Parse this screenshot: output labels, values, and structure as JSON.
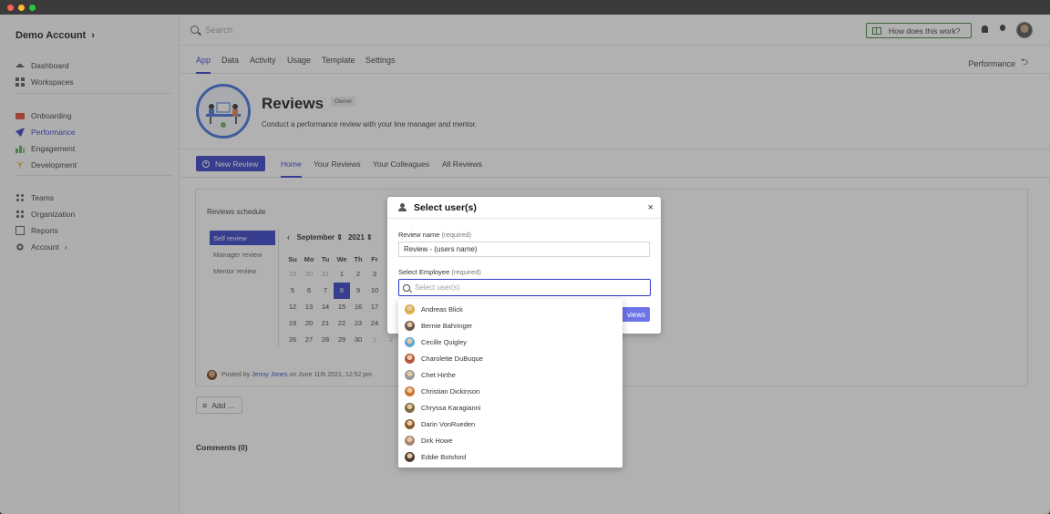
{
  "window": {
    "controls": {
      "close_color": "#ff5f57",
      "minimize_color": "#febc2e",
      "maximize_color": "#28c840"
    }
  },
  "sidebar": {
    "account_title": "Demo Account",
    "account_chevron": "›",
    "groups": [
      [
        {
          "label": "Dashboard",
          "icon": "home-icon"
        },
        {
          "label": "Workspaces",
          "icon": "grid-icon"
        }
      ],
      [
        {
          "label": "Onboarding",
          "icon": "flag-icon"
        },
        {
          "label": "Performance",
          "icon": "paper-plane-icon",
          "active": true
        },
        {
          "label": "Engagement",
          "icon": "chart-icon"
        },
        {
          "label": "Development",
          "icon": "sprout-icon"
        }
      ],
      [
        {
          "label": "Teams",
          "icon": "org-icon"
        },
        {
          "label": "Organization",
          "icon": "network-icon"
        },
        {
          "label": "Reports",
          "icon": "report-icon"
        },
        {
          "label": "Account",
          "icon": "gear-icon",
          "chevron": "›"
        }
      ]
    ]
  },
  "topbar": {
    "search_placeholder": "Search",
    "help_label": "How does this work?"
  },
  "app_tabs": [
    "App",
    "Data",
    "Activity",
    "Usage",
    "Template",
    "Settings"
  ],
  "app_tab_active": "App",
  "performance_link": "Performance",
  "header": {
    "title": "Reviews",
    "badge": "Owner",
    "subtitle": "Conduct a performance review with your line manager and mentor."
  },
  "subnav": {
    "new_review": "New Review",
    "tabs": [
      "Home",
      "Your Reviews",
      "Your Colleagues",
      "All Reviews"
    ],
    "active": "Home"
  },
  "schedule": {
    "title": "Reviews schedule",
    "types": [
      "Self review",
      "Manager review",
      "Mentor review"
    ],
    "active_type": "Self review",
    "calendar": {
      "prev": "‹",
      "month": "September",
      "year": "2021",
      "day_headers": [
        "Su",
        "Mo",
        "Tu",
        "We",
        "Th",
        "Fr"
      ],
      "weeks": [
        [
          "29",
          "30",
          "31",
          "1",
          "2",
          "3"
        ],
        [
          "5",
          "6",
          "7",
          "8",
          "9",
          "10"
        ],
        [
          "12",
          "13",
          "14",
          "15",
          "16",
          "17"
        ],
        [
          "19",
          "20",
          "21",
          "22",
          "23",
          "24"
        ],
        [
          "26",
          "27",
          "28",
          "29",
          "30",
          "1"
        ]
      ],
      "muted": [
        [
          0,
          0
        ],
        [
          0,
          1
        ],
        [
          0,
          2
        ],
        [
          4,
          5
        ]
      ],
      "selected_day": "8",
      "partial_col": [
        "2"
      ]
    },
    "posted_prefix": "Posted by",
    "posted_author": "Jenny Jones",
    "posted_suffix": "on June 11th 2021, 12:52 pm"
  },
  "add_button": "Add ...",
  "comments_label": "Comments (0)",
  "modal": {
    "title": "Select user(s)",
    "close": "×",
    "review_name_label": "Review name",
    "review_name_required": "(required)",
    "review_name_value": "Review - (users name)",
    "employee_label": "Select Employee",
    "employee_required": "(required)",
    "employee_placeholder": "Select user(s)",
    "submit_partial": "views"
  },
  "users": [
    {
      "name": "Andreas Blick",
      "color": "#d8b04a"
    },
    {
      "name": "Bernie Bahringer",
      "color": "#6d5848"
    },
    {
      "name": "Cecille Quigley",
      "color": "#5fa8d3"
    },
    {
      "name": "Charolette DuBuque",
      "color": "#b5563f"
    },
    {
      "name": "Chet Hirthe",
      "color": "#9a9a9a"
    },
    {
      "name": "Christian Dickinson",
      "color": "#c9762f"
    },
    {
      "name": "Chryssa Karagianni",
      "color": "#7a6a3d"
    },
    {
      "name": "Darin VonRueden",
      "color": "#8a5b2d"
    },
    {
      "name": "Dirk Howe",
      "color": "#a88470"
    },
    {
      "name": "Eddie Botsford",
      "color": "#4e3b33"
    }
  ],
  "colors": {
    "accent": "#2d37c4",
    "overlay": "rgba(70,70,70,0.42)"
  }
}
